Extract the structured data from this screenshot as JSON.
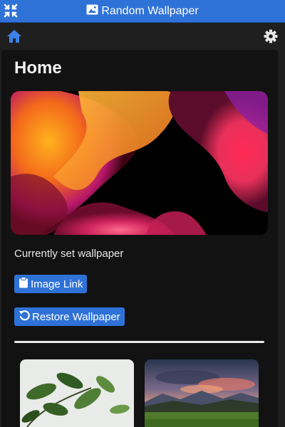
{
  "window": {
    "title": "Random Wallpaper",
    "accent": "#2f72d7"
  },
  "toolbar": {
    "home_icon": "home-icon",
    "settings_icon": "gear-icon"
  },
  "main": {
    "page_title": "Home",
    "current_caption": "Currently set wallpaper",
    "buttons": {
      "image_link": "Image Link",
      "restore": "Restore Wallpaper"
    }
  },
  "history": [
    {
      "icon": "plant-image"
    },
    {
      "icon": "mountain-sunset-image"
    }
  ]
}
